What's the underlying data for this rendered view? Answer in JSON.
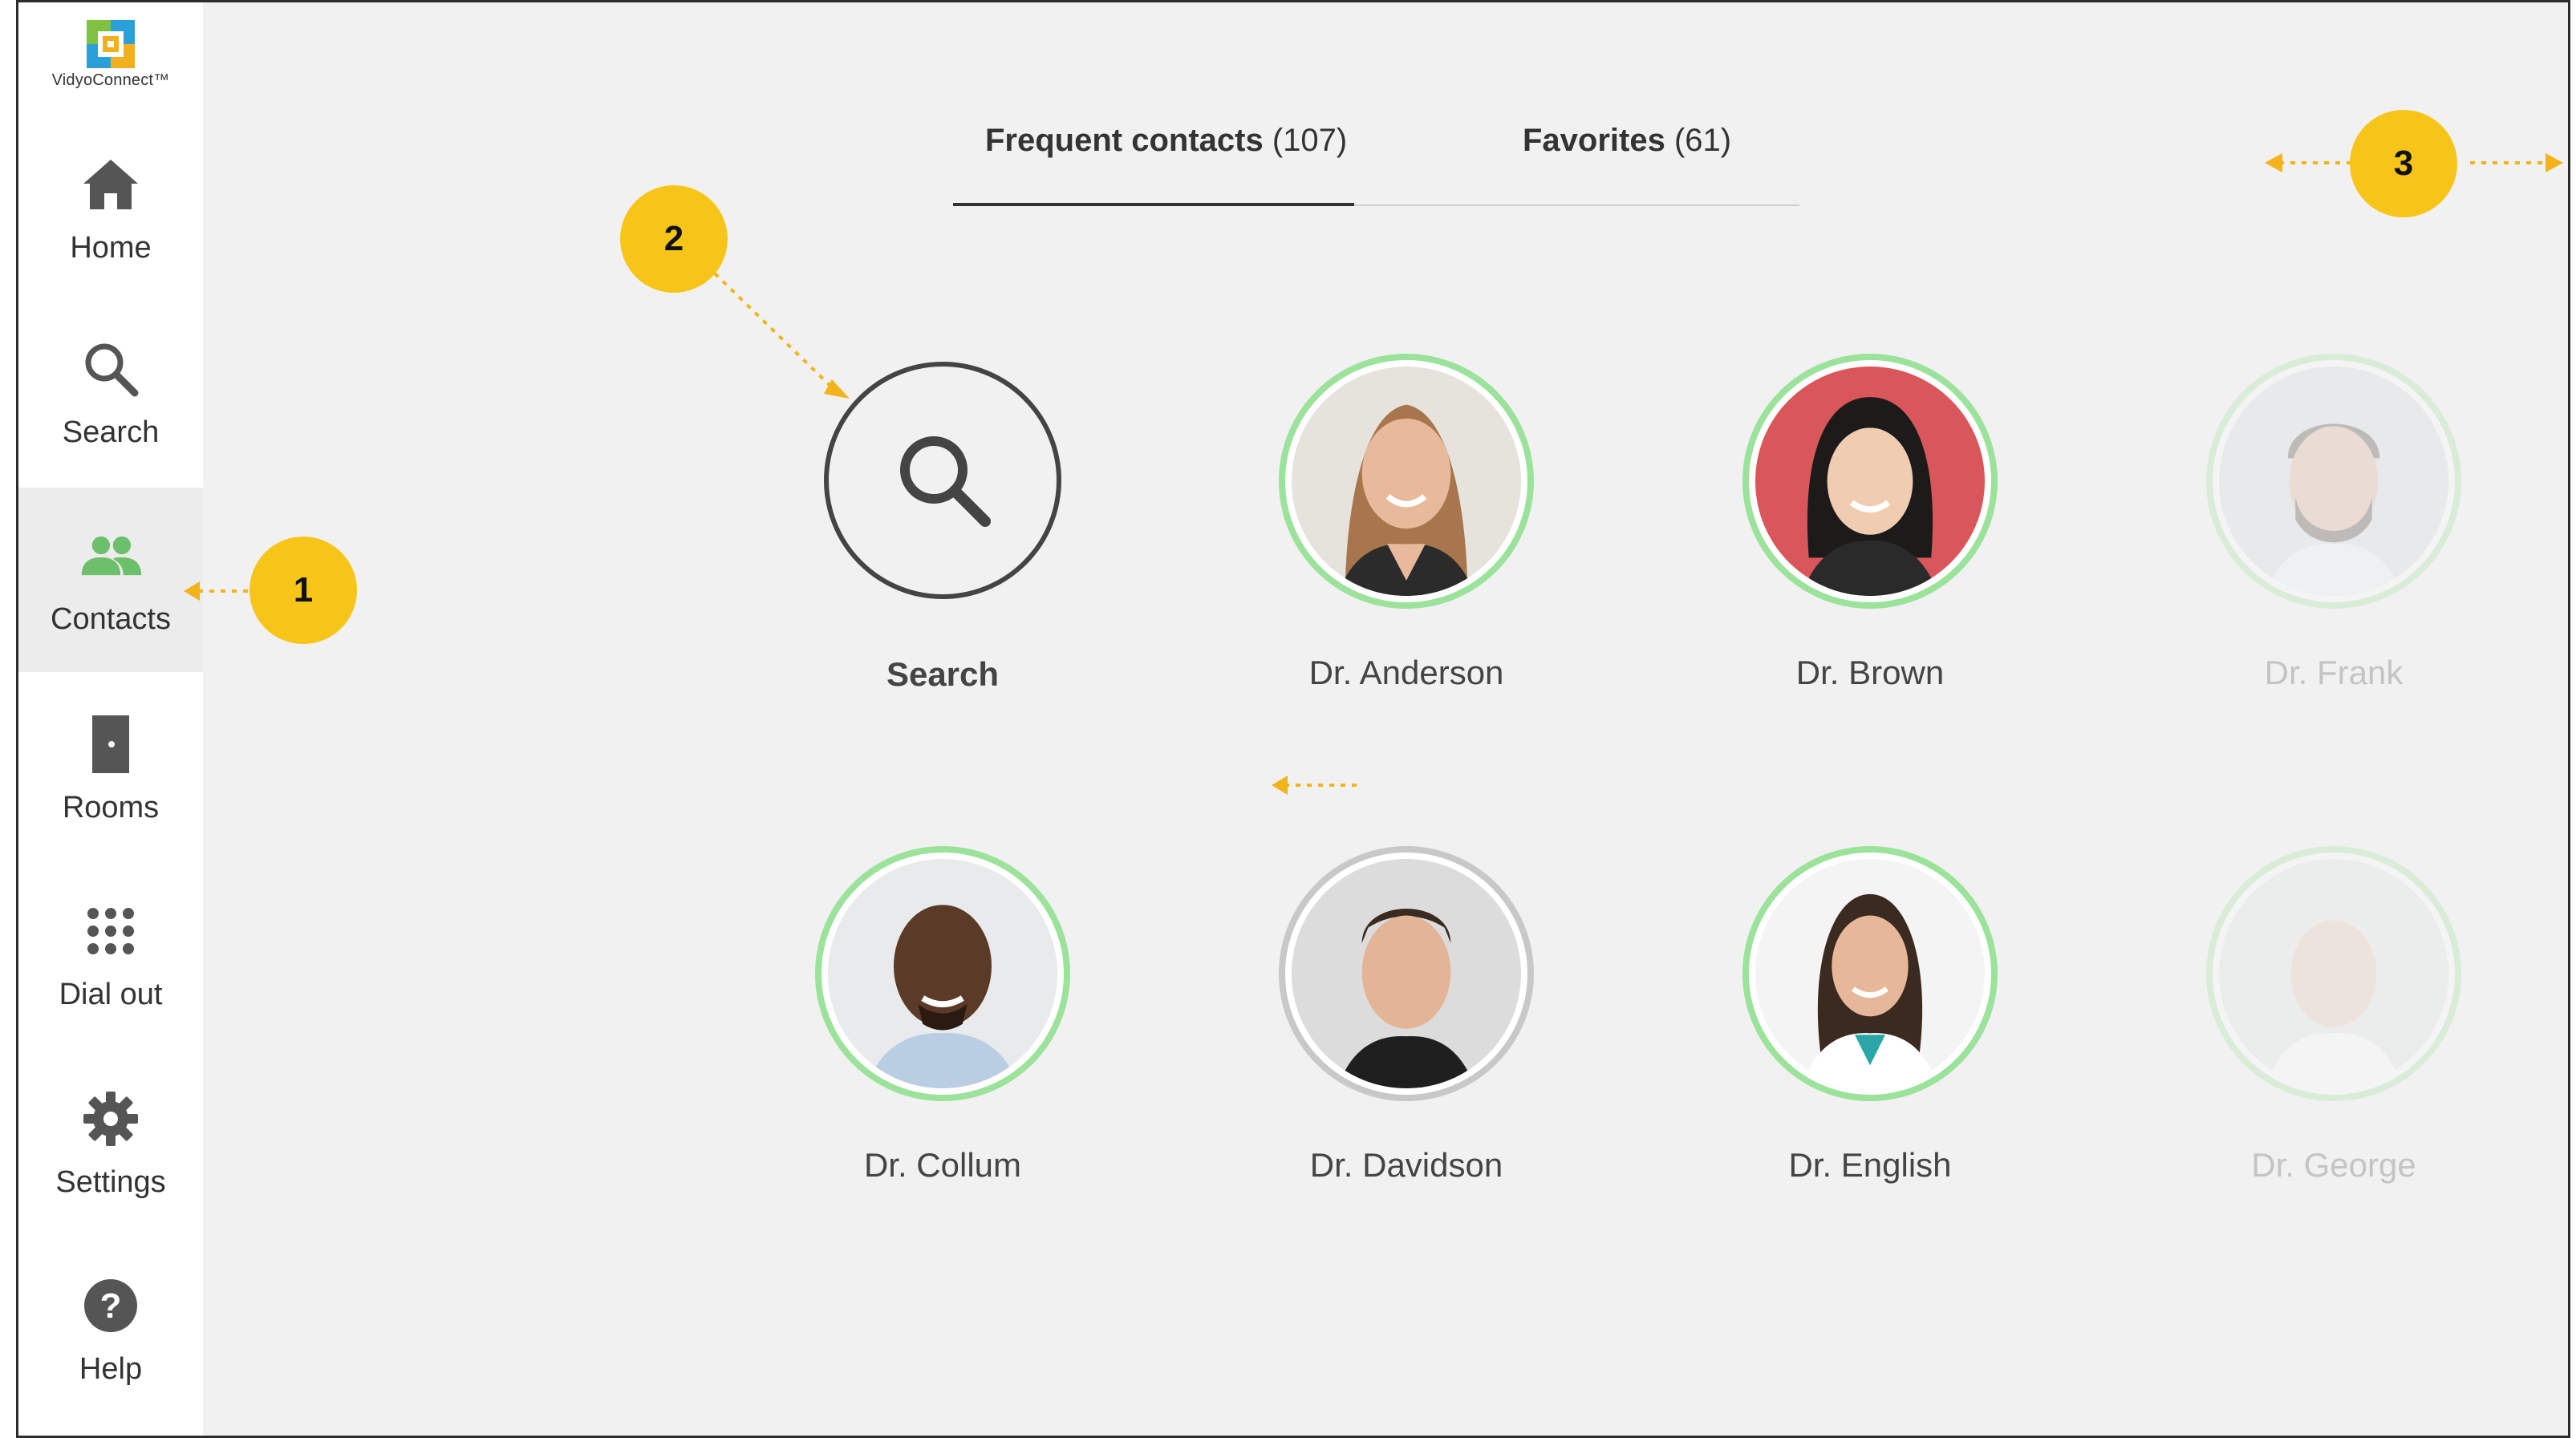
{
  "app": {
    "logo_text": "VidyoConnect™"
  },
  "sidebar": {
    "items": [
      {
        "label": "Home",
        "icon": "home-icon"
      },
      {
        "label": "Search",
        "icon": "search-icon"
      },
      {
        "label": "Contacts",
        "icon": "contacts-icon",
        "active": true
      },
      {
        "label": "Rooms",
        "icon": "door-icon"
      },
      {
        "label": "Dial out",
        "icon": "dialpad-icon"
      },
      {
        "label": "Settings",
        "icon": "gear-icon"
      },
      {
        "label": "Help",
        "icon": "help-icon"
      }
    ]
  },
  "tabs": [
    {
      "label": "Frequent contacts",
      "count": "(107)",
      "selected": true
    },
    {
      "label": "Favorites",
      "count": "(61)",
      "selected": false
    }
  ],
  "search_tile": {
    "label": "Search"
  },
  "contacts": [
    {
      "name": "Dr. Anderson",
      "status": "online"
    },
    {
      "name": "Dr. Brown",
      "status": "online"
    },
    {
      "name": "Dr. Frank",
      "status": "online",
      "faded": true
    },
    {
      "name": "Dr. Collum",
      "status": "online"
    },
    {
      "name": "Dr. Davidson",
      "status": "offline"
    },
    {
      "name": "Dr. English",
      "status": "online"
    },
    {
      "name": "Dr. George",
      "status": "online",
      "faded": true
    }
  ],
  "callouts": [
    "1",
    "2",
    "3"
  ],
  "colors": {
    "online": "#9be29b",
    "offline": "#c8c8c8",
    "callout": "#f7c51a",
    "accent_logo": "#2a9fd8"
  }
}
